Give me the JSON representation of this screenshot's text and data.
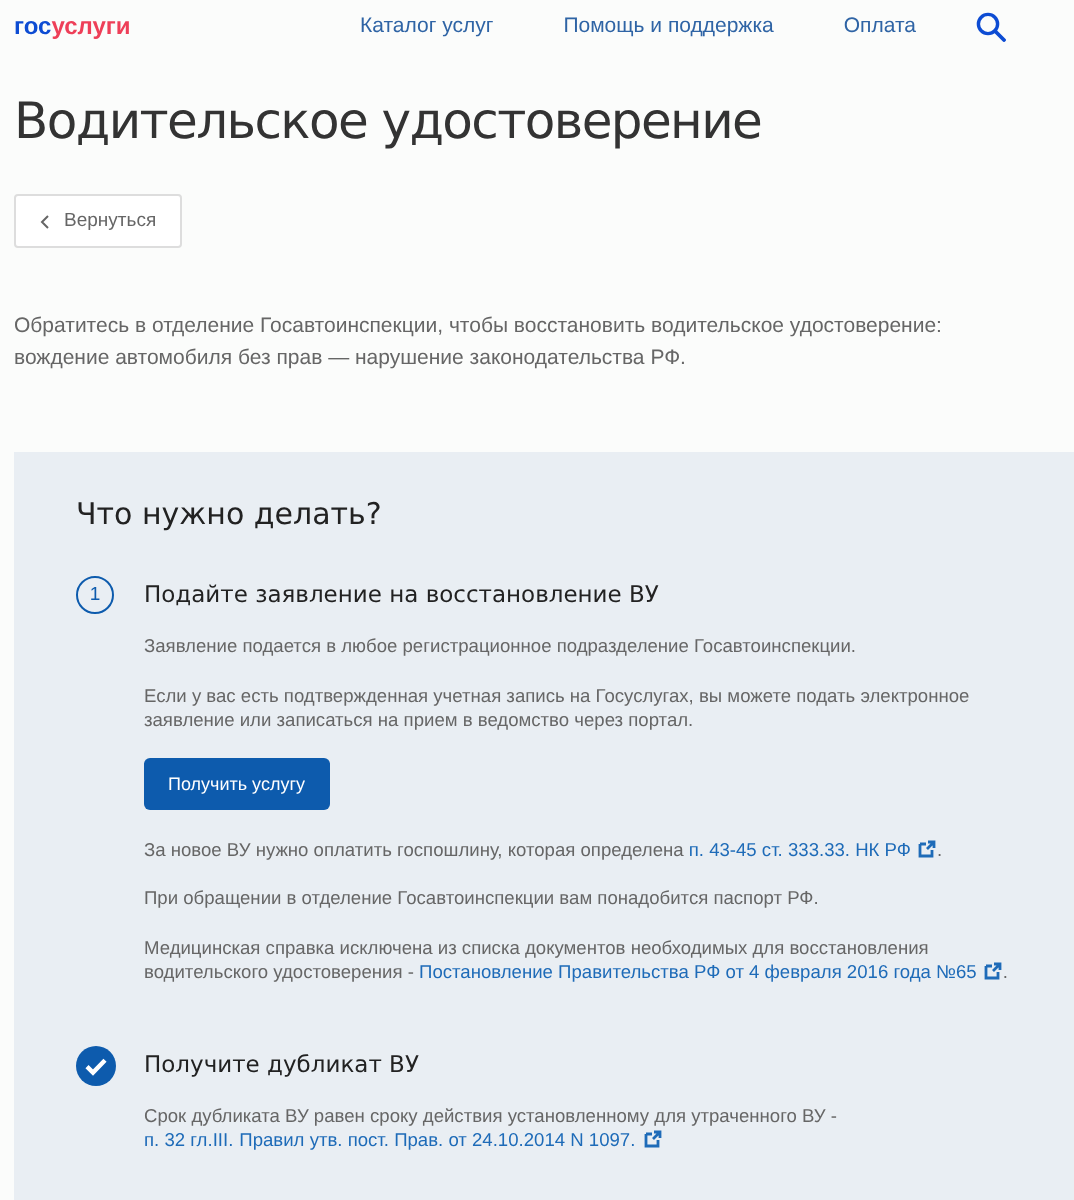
{
  "header": {
    "logo": [
      {
        "text": "гос",
        "kind": "primary"
      },
      {
        "text": "услуги",
        "kind": "accent"
      }
    ],
    "nav": [
      "Каталог услуг",
      "Помощь и поддержка",
      "Оплата"
    ]
  },
  "title": "Водительское удостоверение",
  "back_button": {
    "label": "Вернуться"
  },
  "intro": "Обратитесь в отделение Госавтоинспекции, чтобы восстановить водительское удостоверение: вождение автомобиля без прав — нарушение законодательства РФ.",
  "panel": {
    "title": "Что нужно делать?",
    "steps": [
      {
        "kind": "number",
        "marker": "1",
        "title": "Подайте заявление на восстановление ВУ",
        "blocks": [
          {
            "kind": "paragraph",
            "parts": [
              {
                "kind": "text",
                "text": "Заявление подается в любое регистрационное подразделение Госавтоинспекции."
              }
            ]
          },
          {
            "kind": "paragraph",
            "parts": [
              {
                "kind": "text",
                "text": "Если у вас есть подтвержденная учетная запись на Госуслугах, вы можете подать электронное заявление или записаться на прием в ведомство через портал."
              }
            ]
          },
          {
            "kind": "button",
            "label": "Получить услугу"
          },
          {
            "kind": "paragraph",
            "parts": [
              {
                "kind": "text",
                "text": "За новое ВУ нужно оплатить госпошлину, которая определена "
              },
              {
                "kind": "link",
                "text": "п. 43-45 ст. 333.33. НК РФ"
              },
              {
                "kind": "external"
              },
              {
                "kind": "text",
                "text": "."
              }
            ]
          },
          {
            "kind": "paragraph",
            "parts": [
              {
                "kind": "text",
                "text": "При обращении в отделение Госавтоинспекции вам понадобится паспорт РФ."
              }
            ]
          },
          {
            "kind": "paragraph",
            "parts": [
              {
                "kind": "text",
                "text": "Медицинская справка исключена из списка документов необходимых для восстановления водительского удостоверения - "
              },
              {
                "kind": "link",
                "text": "Постановление Правительства РФ от 4 февраля 2016 года №65"
              },
              {
                "kind": "external"
              },
              {
                "kind": "text",
                "text": "."
              }
            ]
          }
        ]
      },
      {
        "kind": "done",
        "title": "Получите дубликат ВУ",
        "blocks": [
          {
            "kind": "paragraph",
            "parts": [
              {
                "kind": "text",
                "text": "Срок дубликата ВУ равен сроку действия установленному для утраченного ВУ - "
              },
              {
                "kind": "link",
                "text": "п. 32 гл.III."
              },
              {
                "kind": "link",
                "text": "Правил утв. пост. Прав. от 24.10.2014 N 1097."
              },
              {
                "kind": "external"
              }
            ]
          }
        ]
      }
    ]
  }
}
